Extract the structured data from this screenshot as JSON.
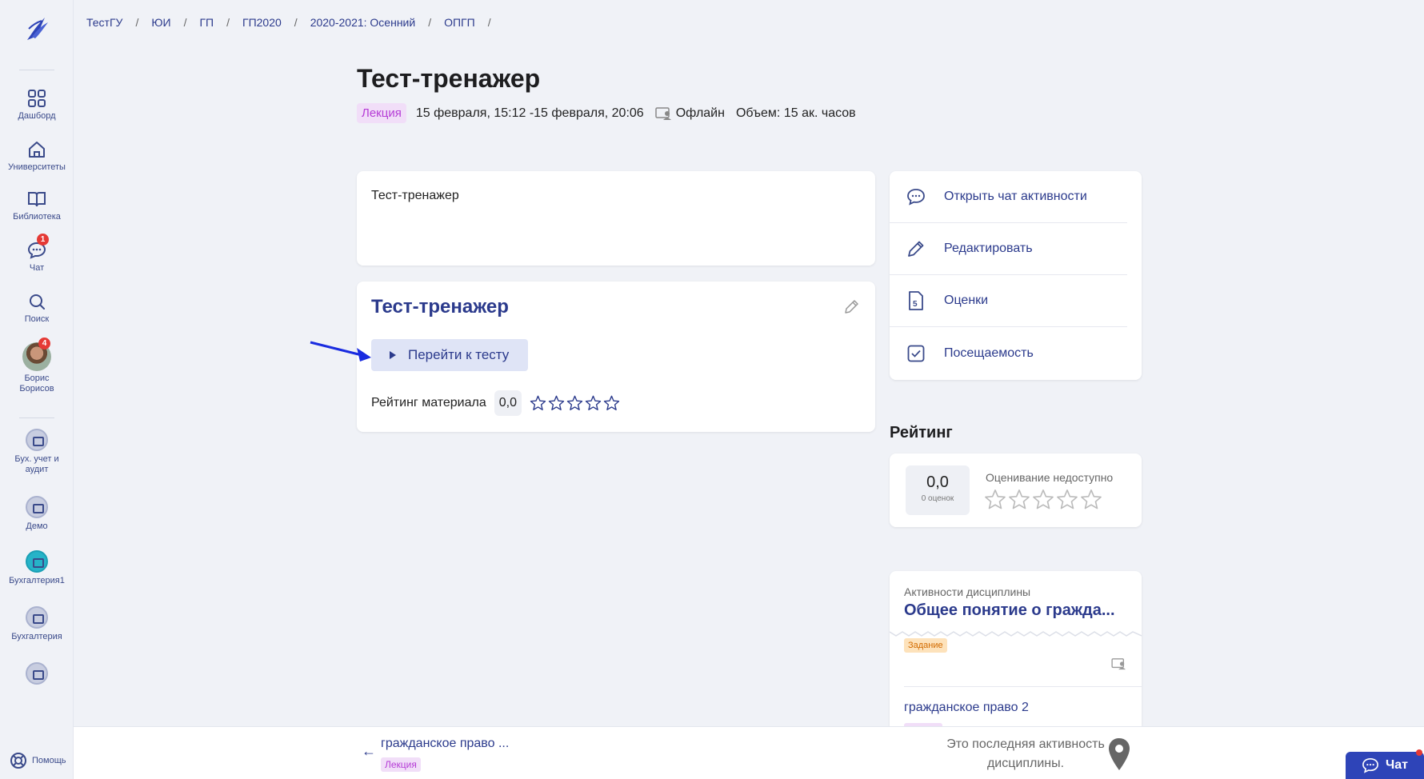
{
  "breadcrumb": [
    "ТестГУ",
    "ЮИ",
    "ГП",
    "ГП2020",
    "2020-2021: Осенний",
    "ОПГП"
  ],
  "sidebar": {
    "items": [
      {
        "label": "Дашборд",
        "icon": "grid-icon"
      },
      {
        "label": "Университеты",
        "icon": "home-icon"
      },
      {
        "label": "Библиотека",
        "icon": "book-icon"
      },
      {
        "label": "Чат",
        "icon": "chat-icon",
        "badge": "1"
      },
      {
        "label": "Поиск",
        "icon": "search-icon"
      }
    ],
    "profile": {
      "name_line1": "Борис",
      "name_line2": "Борисов",
      "badge": "4"
    },
    "courses": [
      {
        "label_line1": "Бух. учет и",
        "label_line2": "аудит"
      },
      {
        "label_line1": "Демо",
        "label_line2": ""
      },
      {
        "label_line1": "Бухгалтерия1",
        "label_line2": ""
      },
      {
        "label_line1": "Бухгалтерия",
        "label_line2": ""
      },
      {
        "label_line1": "",
        "label_line2": ""
      }
    ],
    "help": "Помощь"
  },
  "page": {
    "title": "Тест-тренажер",
    "tag": "Лекция",
    "dates": "15 февраля, 15:12 -15 февраля, 20:06",
    "mode": "Офлайн",
    "volume": "Объем: 15 ак. часов"
  },
  "description": "Тест-тренажер",
  "test_card": {
    "title": "Тест-тренажер",
    "button": "Перейти к тесту",
    "rating_label": "Рейтинг материала",
    "rating_value": "0,0"
  },
  "actions": [
    {
      "label": "Открыть чат активности",
      "icon": "chat-bubble-icon"
    },
    {
      "label": "Редактировать",
      "icon": "pencil-icon"
    },
    {
      "label": "Оценки",
      "icon": "grades-file-icon"
    },
    {
      "label": "Посещаемость",
      "icon": "checkbox-icon"
    }
  ],
  "rating": {
    "section_title": "Рейтинг",
    "value": "0,0",
    "count": "0 оценок",
    "note": "Оценивание недоступно"
  },
  "activities": {
    "subtitle": "Активности дисциплины",
    "title": "Общее понятие о гражда...",
    "task_tag": "Задание",
    "item2": "гражданское право 2"
  },
  "bottom": {
    "prev_title": "гражданское право ...",
    "prev_tag": "Лекция",
    "last_line1": "Это последняя активность",
    "last_line2": "дисциплины."
  },
  "chat_button": "Чат",
  "colors": {
    "accent": "#2b3a8c",
    "lecture_tag": "#b53cd6",
    "task_tag": "#d26b00",
    "badge": "#e53935",
    "chat_button": "#2e44b8"
  }
}
